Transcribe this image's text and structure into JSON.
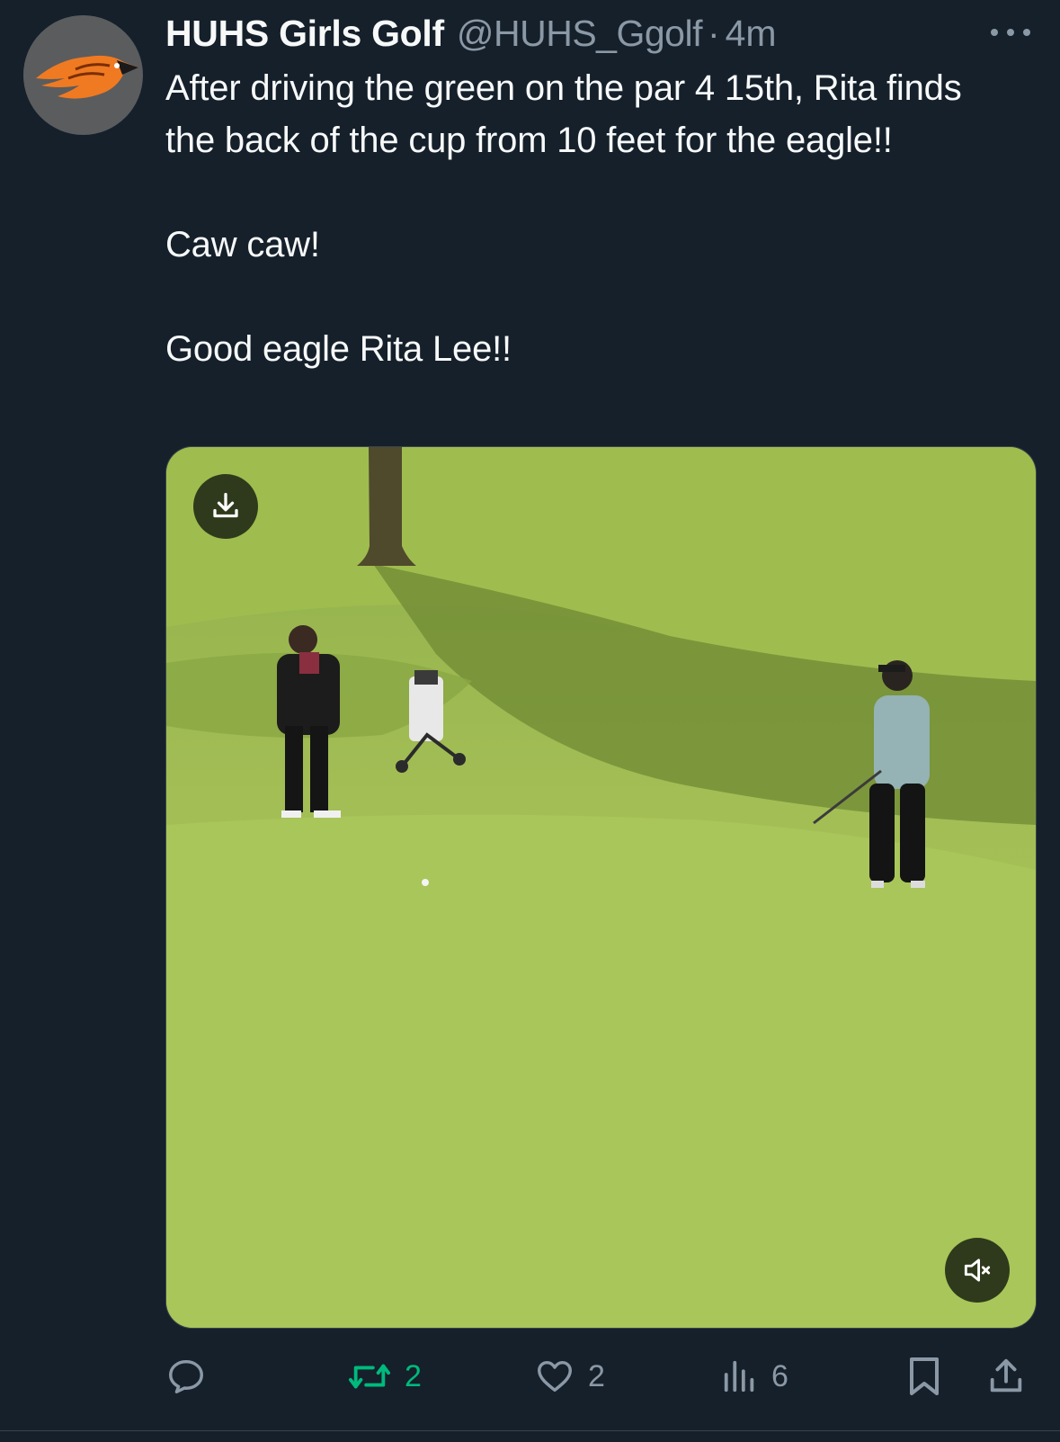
{
  "tweet": {
    "display_name": "HUHS Girls Golf",
    "handle": "@HUHS_Ggolf",
    "separator": "·",
    "time": "4m",
    "text": "After driving the green on the par 4 15th, Rita finds the back of the cup from 10 feet for the eagle!!\n\nCaw caw!\n\nGood eagle Rita Lee!!"
  },
  "media": {
    "type": "video",
    "download_icon": "download-icon",
    "mute_icon": "speaker-muted-icon"
  },
  "actions": {
    "reply": {
      "icon": "reply-icon"
    },
    "retweet": {
      "icon": "retweet-icon",
      "count": "2",
      "color": "#00ba7c"
    },
    "like": {
      "icon": "heart-icon",
      "count": "2"
    },
    "views": {
      "icon": "views-chart-icon",
      "count": "6"
    },
    "bookmark": {
      "icon": "bookmark-icon"
    },
    "share": {
      "icon": "share-icon"
    }
  },
  "colors": {
    "background": "#15202b",
    "text": "#f7f9f9",
    "secondary": "#8b98a5",
    "retweet_active": "#00ba7c"
  }
}
